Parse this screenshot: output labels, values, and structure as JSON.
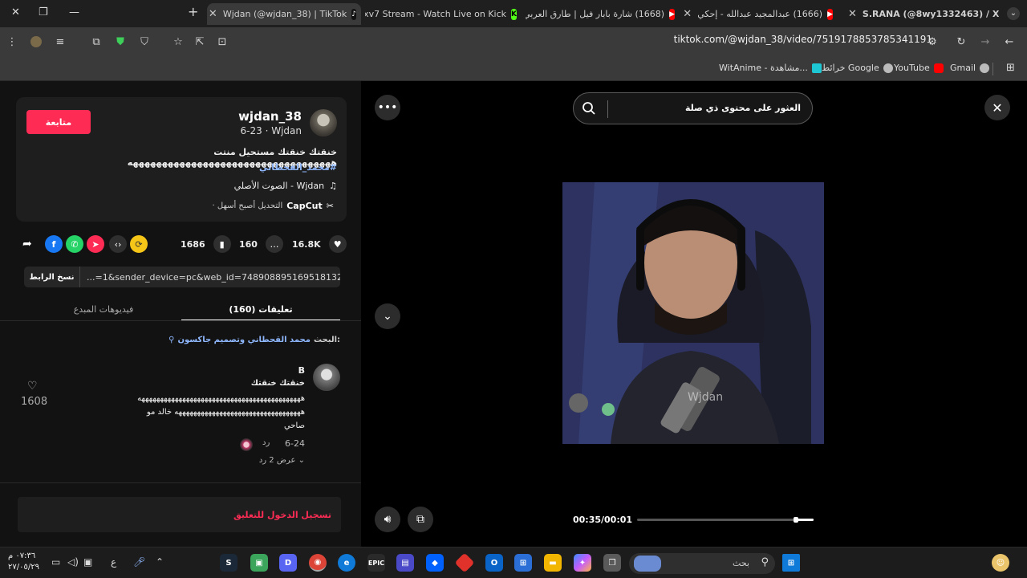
{
  "browser": {
    "tabs": [
      {
        "title": "S.RANA (@8wy1332463) / X",
        "icon": "x-icon"
      },
      {
        "title": "(1666) عبدالمجيد عبدالله - إحكي",
        "icon": "youtube-icon"
      },
      {
        "title": "(1668) شارة بابار فيل | طارق العربي",
        "icon": "youtube-icon"
      },
      {
        "title": "Nxv7 Stream - Watch Live on Kick",
        "icon": "kick-icon"
      },
      {
        "title": "Wjdan (@wjdan_38) | TikTok",
        "icon": "tiktok-icon",
        "active": true
      }
    ],
    "url": "tiktok.com/@wjdan_38/video/7519178853785341191",
    "bookmarks": [
      {
        "label": "Gmail",
        "icon": "gmail-icon"
      },
      {
        "label": "YouTube",
        "icon": "youtube-icon"
      },
      {
        "label": "خرائط Google",
        "icon": "maps-icon"
      },
      {
        "label": "WitAnime - مشاهدة...",
        "icon": "witanime-icon"
      }
    ]
  },
  "post": {
    "follow_label": "متابعة",
    "username": "wjdan_38",
    "subtitle": "6-23 · Wjdan",
    "description": "خنقتك خنقتك مستحيل منتت هههههههههههههههههههههههههههههههههههه",
    "hashtag": "#محمد_القحطاني",
    "music": "الصوت الأصلي - Wjdan",
    "capcut_brand": "CapCut",
    "capcut_text": "· التحديل أصبح أسهل",
    "likes": "16.8K",
    "comments": "160",
    "saves": "1686",
    "copy_link_label": "نسخ الرابط",
    "link_text": "...=1&sender_device=pc&web_id=7489088951695181320"
  },
  "tabs": {
    "comments_label": "(160) تعليقات",
    "creator_videos_label": "فيديوهات المبدع"
  },
  "search": {
    "prefix": "البحث:",
    "query": "محمد القحطاني وتصميم جاكسون"
  },
  "comment": {
    "author": "B",
    "line1": "خنقتك خنقتك",
    "line2": "ههههههههههههههههههههههههههههههههههههههههههههه",
    "line3": "ههههههههههههههههههههههههههههههههههه خالد مو",
    "line4": "صاحي",
    "date": "6-24",
    "reply": "رد",
    "likes": "1608",
    "view_replies": "عرض 2 رد"
  },
  "login_prompt": "تسجيل الدخول للتعليق",
  "video": {
    "search_placeholder": "العثور على محتوى ذي صلة",
    "watermark": "Wjdan",
    "time": "00:35/00:01",
    "progress": 0.9
  },
  "taskbar": {
    "search_placeholder": "بحث",
    "clock_time": "٠٧:٣٦ م",
    "clock_date": "٢٧/٠٥/٢٩",
    "lang": "ع"
  }
}
